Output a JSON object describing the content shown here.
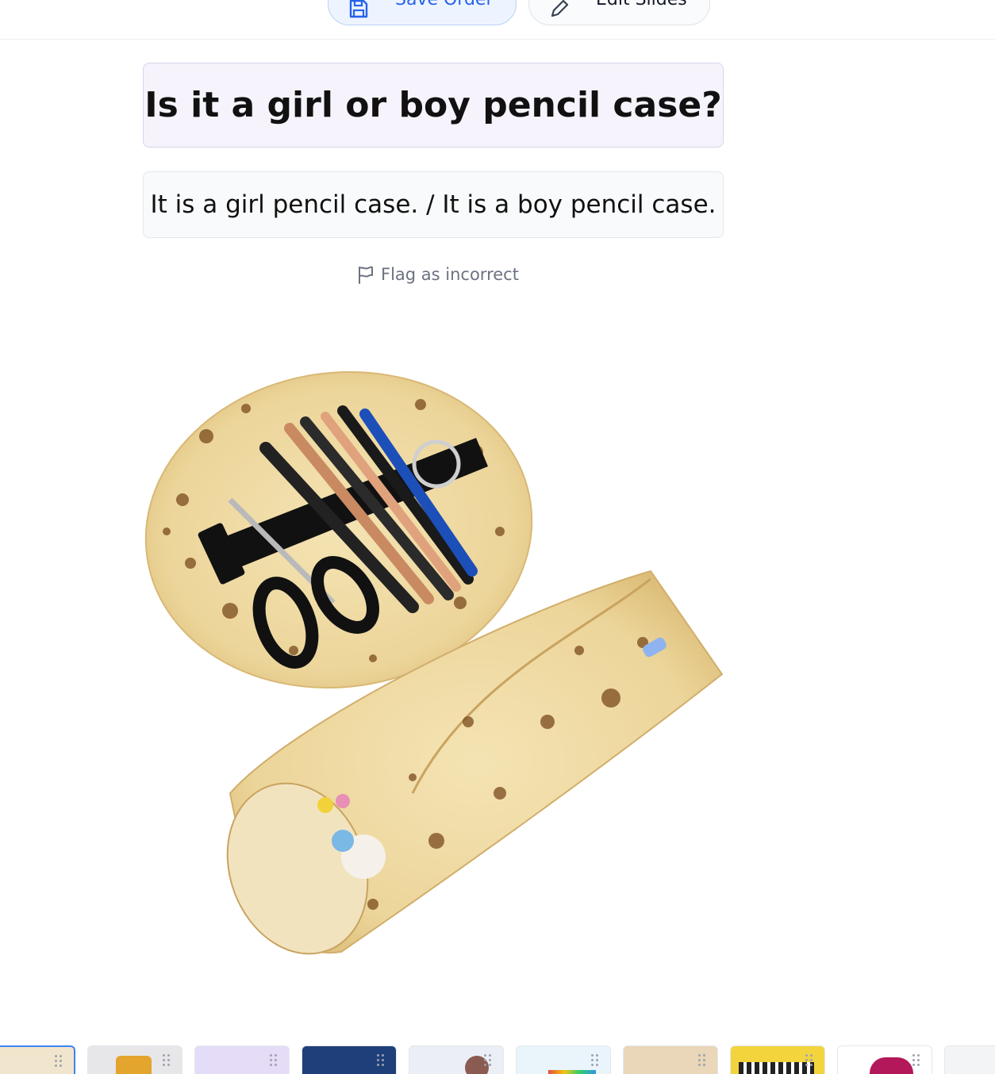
{
  "toolbar": {
    "save_label": "Save Order",
    "edit_label": "Edit Slides"
  },
  "slide": {
    "question": "Is it a girl or boy pencil case?",
    "answer": "It is a girl pencil case. / It is a boy pencil case.",
    "flag_label": "Flag as incorrect",
    "image_icon": "burrito-pencil-case-photo"
  },
  "colors": {
    "accent": "#2563eb",
    "question_bg": "#f6f3fc",
    "answer_bg": "#f9fafb"
  },
  "thumbnails": [
    {
      "icon": "thumbnail-image",
      "active": true
    },
    {
      "icon": "thumbnail-image"
    },
    {
      "icon": "thumbnail-image"
    },
    {
      "icon": "thumbnail-image"
    },
    {
      "icon": "thumbnail-image"
    },
    {
      "icon": "thumbnail-image"
    },
    {
      "icon": "thumbnail-image"
    },
    {
      "icon": "thumbnail-image"
    },
    {
      "icon": "thumbnail-image"
    },
    {
      "icon": "thumbnail-image"
    }
  ]
}
